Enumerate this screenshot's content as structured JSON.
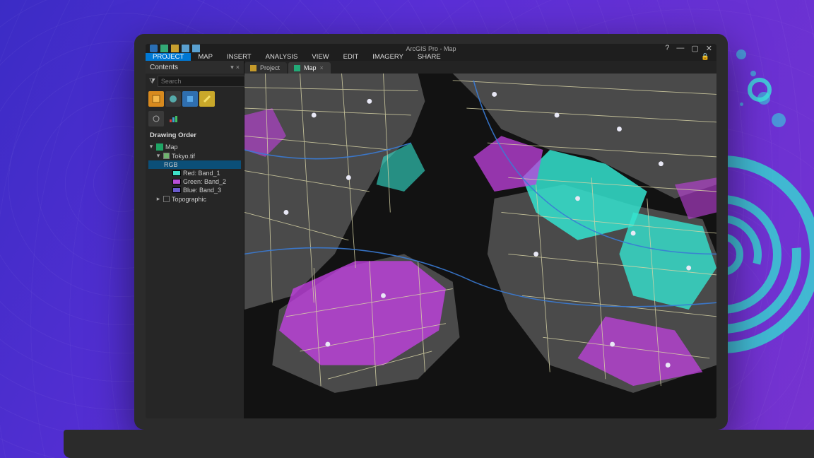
{
  "app": {
    "title": "ArcGIS Pro - Map",
    "help_icon": "?",
    "minimize": "—",
    "maximize": "▢",
    "close": "✕",
    "lock_icon": "🔒"
  },
  "menubar": {
    "tabs": [
      "PROJECT",
      "MAP",
      "INSERT",
      "ANALYSIS",
      "VIEW",
      "EDIT",
      "IMAGERY",
      "SHARE"
    ],
    "active": "PROJECT"
  },
  "contents": {
    "title": "Contents",
    "pin": "▾",
    "close": "×",
    "funnel": "⧩",
    "search_placeholder": "Search",
    "search_icon": "⌕",
    "section": "Drawing Order",
    "root": "Map",
    "layer": "Tokyo.tif",
    "renderer": "RGB",
    "bands": [
      {
        "label": "Red: Band_1"
      },
      {
        "label": "Green: Band_2"
      },
      {
        "label": "Blue: Band_3"
      }
    ],
    "basemap": "Topographic"
  },
  "view_tabs": {
    "project": "Project",
    "map": "Map",
    "close": "×"
  },
  "colors": {
    "accent_blue": "#0078d4",
    "overlay_cyan": "#34e3cf",
    "overlay_magenta": "#c141e0",
    "road": "#d8d4a6",
    "road_blue": "#3a7bd5",
    "water": "#141414",
    "land": "#4a4a4a"
  }
}
